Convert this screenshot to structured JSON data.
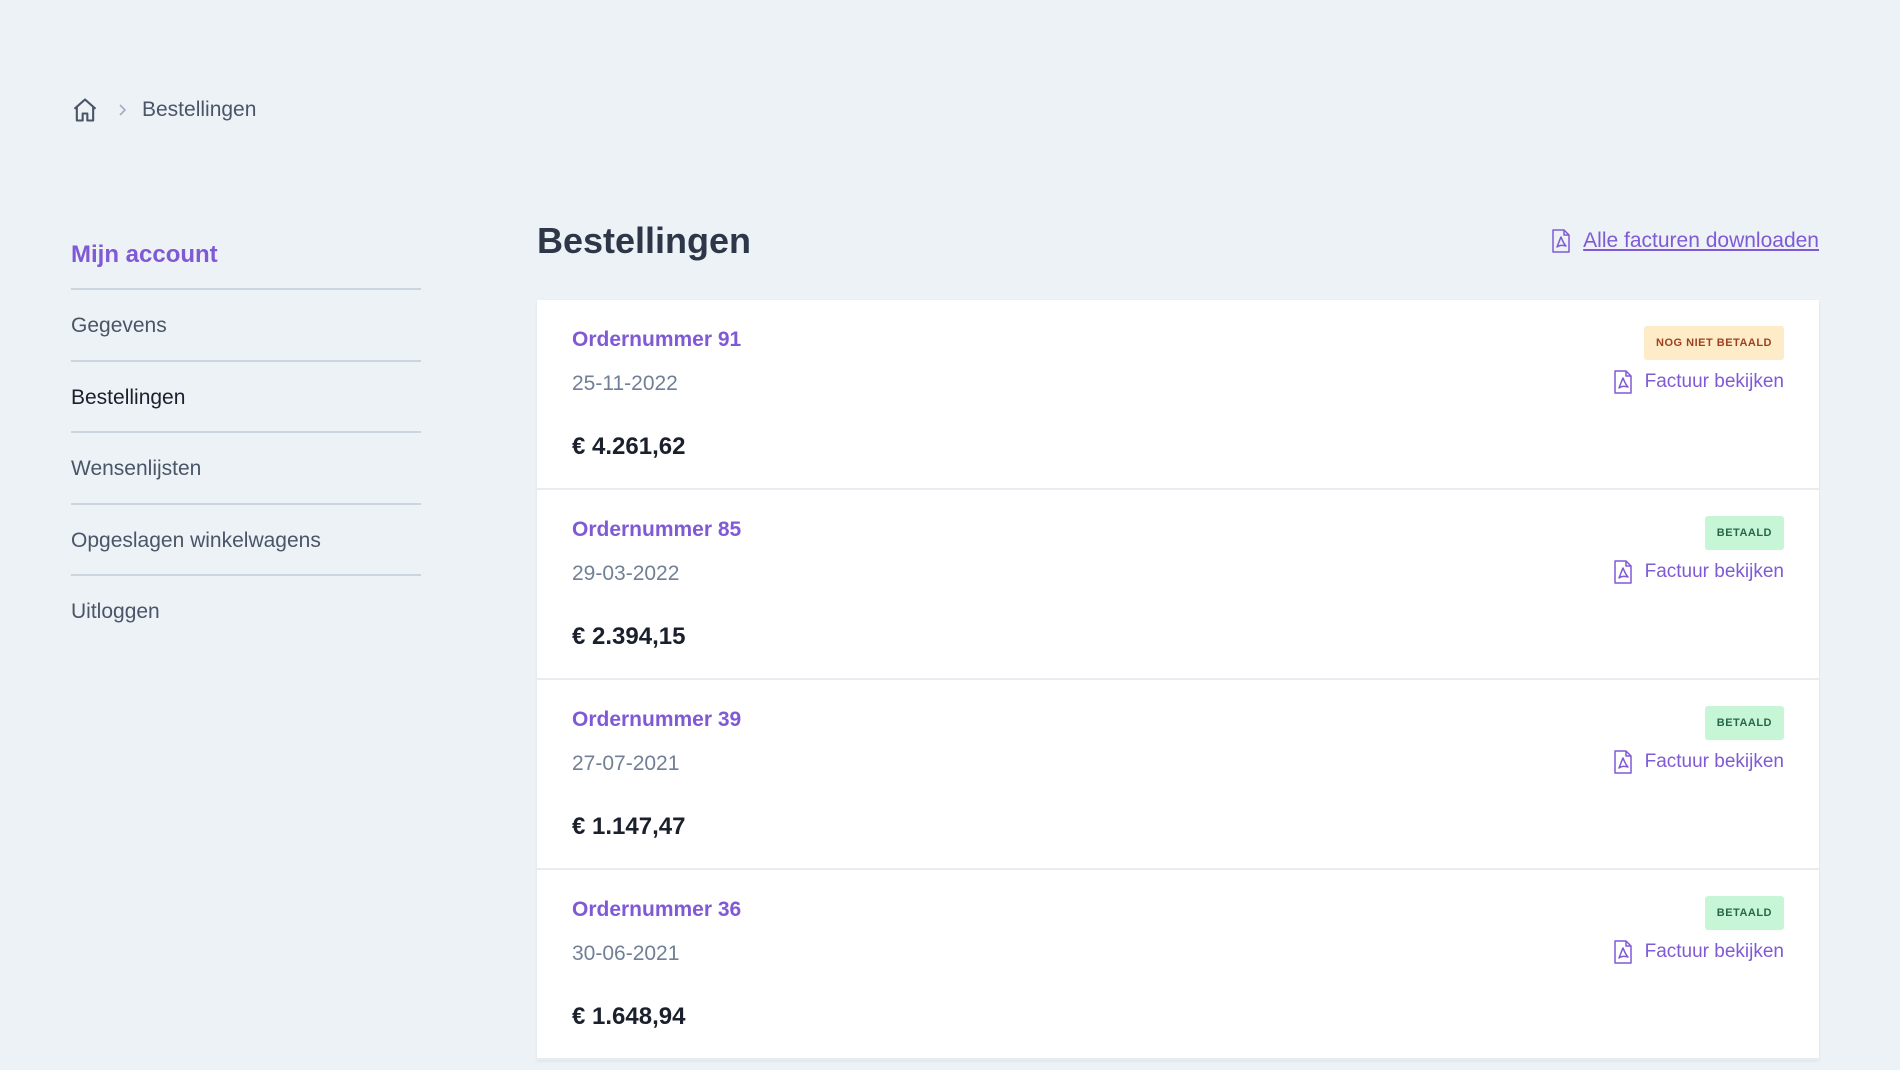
{
  "breadcrumb": {
    "home_icon": "home-icon",
    "current": "Bestellingen"
  },
  "sidebar": {
    "title": "Mijn account",
    "items": [
      {
        "label": "Gegevens"
      },
      {
        "label": "Bestellingen"
      },
      {
        "label": "Wensenlijsten"
      },
      {
        "label": "Opgeslagen winkelwagens"
      },
      {
        "label": "Uitloggen"
      }
    ]
  },
  "main": {
    "title": "Bestellingen",
    "download_all_label": "Alle facturen downloaden"
  },
  "orders": [
    {
      "number": "Ordernummer 91",
      "date": "25-11-2022",
      "amount": "€ 4.261,62",
      "status": "NOG NIET BETAALD",
      "invoice_label": "Factuur bekijken"
    },
    {
      "number": "Ordernummer 85",
      "date": "29-03-2022",
      "amount": "€ 2.394,15",
      "status": "BETAALD",
      "invoice_label": "Factuur bekijken"
    },
    {
      "number": "Ordernummer 39",
      "date": "27-07-2021",
      "amount": "€ 1.147,47",
      "status": "BETAALD",
      "invoice_label": "Factuur bekijken"
    },
    {
      "number": "Ordernummer 36",
      "date": "30-06-2021",
      "amount": "€ 1.648,94",
      "status": "BETAALD",
      "invoice_label": "Factuur bekijken"
    }
  ],
  "colors": {
    "accent": "#805ad5",
    "background": "#edf2f7",
    "unpaid_badge": "#feebc8",
    "paid_badge": "#c6f6d5"
  }
}
